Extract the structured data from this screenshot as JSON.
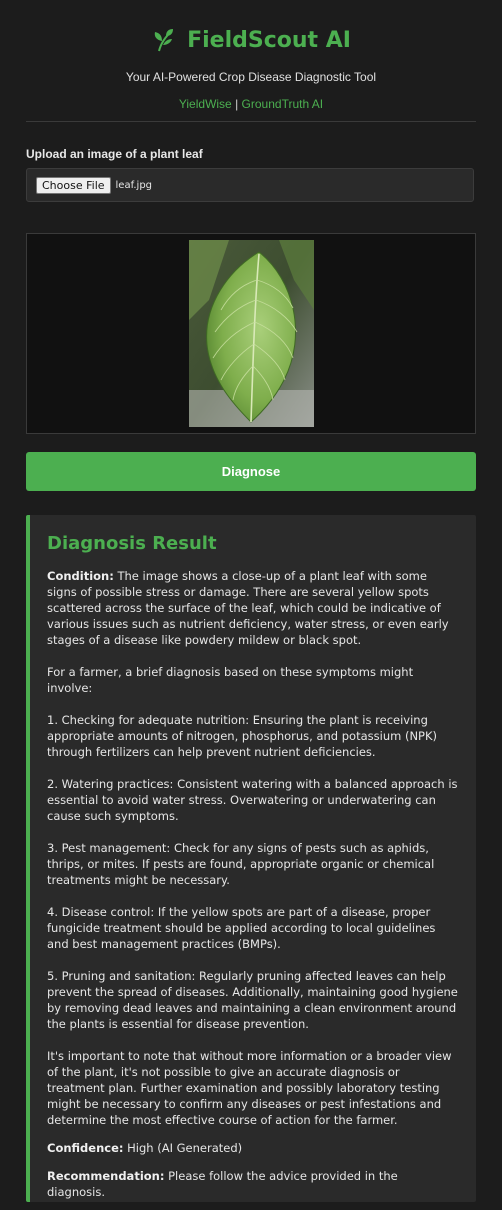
{
  "header": {
    "title": "FieldScout AI",
    "tagline": "Your AI-Powered Crop Disease Diagnostic Tool",
    "link_1": "YieldWise",
    "separator": "|",
    "link_2": "GroundTruth AI"
  },
  "upload": {
    "label": "Upload an image of a plant leaf",
    "button_label": "Choose File",
    "file_name": "leaf.jpg"
  },
  "diagnose_button": "Diagnose",
  "result": {
    "heading": "Diagnosis Result",
    "condition_label": "Condition:",
    "condition_text": " The image shows a close-up of a plant leaf with some signs of possible stress or damage. There are several yellow spots scattered across the surface of the leaf, which could be indicative of various issues such as nutrient deficiency, water stress, or even early stages of a disease like powdery mildew or black spot.",
    "intro": "For a farmer, a brief diagnosis based on these symptoms might involve:",
    "points": [
      "1. Checking for adequate nutrition: Ensuring the plant is receiving appropriate amounts of nitrogen, phosphorus, and potassium (NPK) through fertilizers can help prevent nutrient deficiencies.",
      "2. Watering practices: Consistent watering with a balanced approach is essential to avoid water stress. Overwatering or underwatering can cause such symptoms.",
      "3. Pest management: Check for any signs of pests such as aphids, thrips, or mites. If pests are found, appropriate organic or chemical treatments might be necessary.",
      "4. Disease control: If the yellow spots are part of a disease, proper fungicide treatment should be applied according to local guidelines and best management practices (BMPs).",
      "5. Pruning and sanitation: Regularly pruning affected leaves can help prevent the spread of diseases. Additionally, maintaining good hygiene by removing dead leaves and maintaining a clean environment around the plants is essential for disease prevention."
    ],
    "closing": "It's important to note that without more information or a broader view of the plant, it's not possible to give an accurate diagnosis or treatment plan. Further examination and possibly laboratory testing might be necessary to confirm any diseases or pest infestations and determine the most effective course of action for the farmer.",
    "confidence_label": "Confidence:",
    "confidence_value": " High (AI Generated)",
    "recommendation_label": "Recommendation:",
    "recommendation_value": " Please follow the advice provided in the diagnosis."
  },
  "icons": {
    "logo": "leaf-sprout-icon",
    "preview": "leaf-image"
  },
  "colors": {
    "accent": "#4caf50",
    "background": "#1c1c1c",
    "panel": "#2a2a2a"
  }
}
